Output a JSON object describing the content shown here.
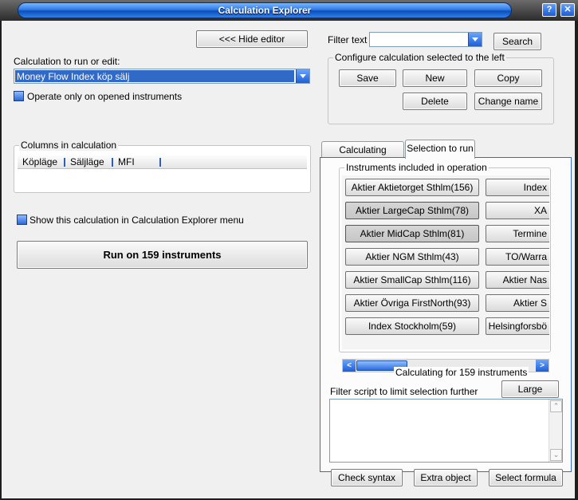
{
  "window": {
    "title": "Calculation Explorer",
    "help_glyph": "?",
    "close_glyph": "✕"
  },
  "left": {
    "hide_editor_label": "<<< Hide editor",
    "calc_label": "Calculation to run or edit:",
    "calc_value": "Money Flow Index köp sälj",
    "operate_only_opened": "Operate only on opened instruments",
    "columns_title": "Columns in calculation",
    "columns": [
      "Köpläge",
      "Säljläge",
      "MFI"
    ],
    "show_in_menu": "Show this calculation in Calculation Explorer menu",
    "run_label": "Run on 159 instruments"
  },
  "right": {
    "filter_label": "Filter text",
    "filter_value": "",
    "search_label": "Search",
    "configure_title": "Configure calculation selected to the left",
    "buttons": {
      "save": "Save",
      "new": "New",
      "copy": "Copy",
      "delete": "Delete",
      "change_name": "Change name"
    },
    "tabs": [
      "Calculating columns",
      "Selection to run"
    ],
    "instruments_title": "Instruments included in operation",
    "instruments_left": [
      "Aktier Aktietorget Sthlm(156)",
      "Aktier LargeCap Sthlm(78)",
      "Aktier MidCap Sthlm(81)",
      "Aktier NGM Sthlm(43)",
      "Aktier SmallCap Sthlm(116)",
      "Aktier Övriga FirstNorth(93)",
      "Index Stockholm(59)"
    ],
    "instruments_right": [
      "Index",
      "XA",
      "Termine",
      "TO/Warra",
      "Aktier Nas",
      "Aktier S",
      "Helsingforsbö"
    ],
    "status_text": "Calculating for 159 instruments",
    "filter_script_label": "Filter script to limit selection further",
    "large_label": "Large",
    "check_syntax": "Check syntax",
    "extra_object": "Extra object",
    "select_formula": "Select formula"
  }
}
